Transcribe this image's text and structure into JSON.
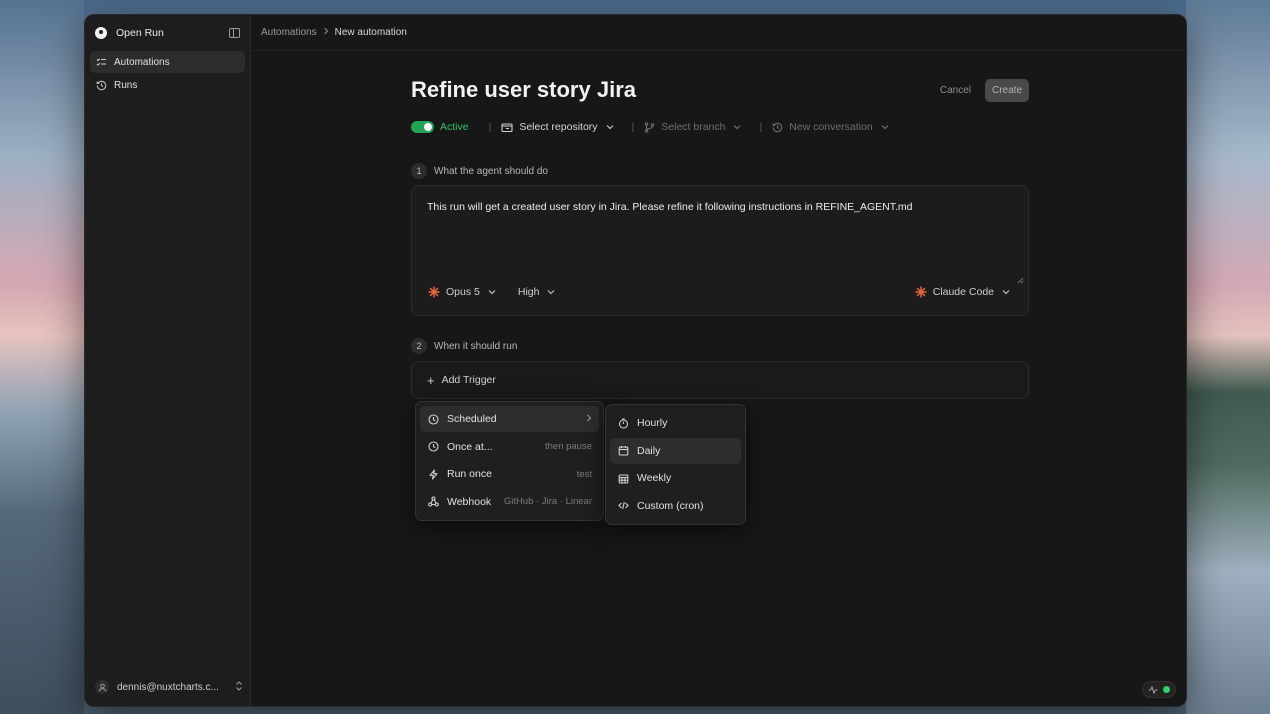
{
  "app": {
    "name": "Open Run",
    "colors": {
      "accent_green": "#22a356",
      "active_text": "#30c46b",
      "status_dot": "#2fcf6e",
      "claude_orange": "#e8653c"
    }
  },
  "sidebar": {
    "items": [
      {
        "label": "Automations",
        "icon": "checklist-icon",
        "active": true
      },
      {
        "label": "Runs",
        "icon": "history-icon",
        "active": false
      }
    ],
    "user": {
      "email": "dennis@nuxtcharts.c..."
    }
  },
  "breadcrumb": {
    "parent": "Automations",
    "current": "New automation"
  },
  "page": {
    "title": "Refine user story Jira",
    "cancel_label": "Cancel",
    "create_label": "Create"
  },
  "meta": {
    "status": "Active",
    "repository": "Select repository",
    "branch": "Select branch",
    "conversation": "New conversation"
  },
  "step1": {
    "number": "1",
    "label": "What the agent should do",
    "prompt": "This run will get a created user story in Jira. Please refine it following instructions in REFINE_AGENT.md",
    "model": "Opus 5",
    "effort": "High",
    "agent": "Claude Code"
  },
  "step2": {
    "number": "2",
    "label": "When it should run",
    "add_trigger": "Add Trigger"
  },
  "trigger_menu": {
    "items": [
      {
        "label": "Scheduled",
        "hint": "",
        "icon": "clock-icon",
        "has_submenu": true
      },
      {
        "label": "Once at...",
        "hint": "then pause",
        "icon": "clock-icon"
      },
      {
        "label": "Run once",
        "hint": "test",
        "icon": "bolt-icon"
      },
      {
        "label": "Webhook",
        "hint": "GitHub · Jira · Linear",
        "icon": "webhook-icon"
      }
    ]
  },
  "schedule_submenu": {
    "items": [
      {
        "label": "Hourly",
        "icon": "timer-icon"
      },
      {
        "label": "Daily",
        "icon": "calendar-icon"
      },
      {
        "label": "Weekly",
        "icon": "calendar-grid-icon"
      },
      {
        "label": "Custom (cron)",
        "icon": "code-icon"
      }
    ]
  }
}
